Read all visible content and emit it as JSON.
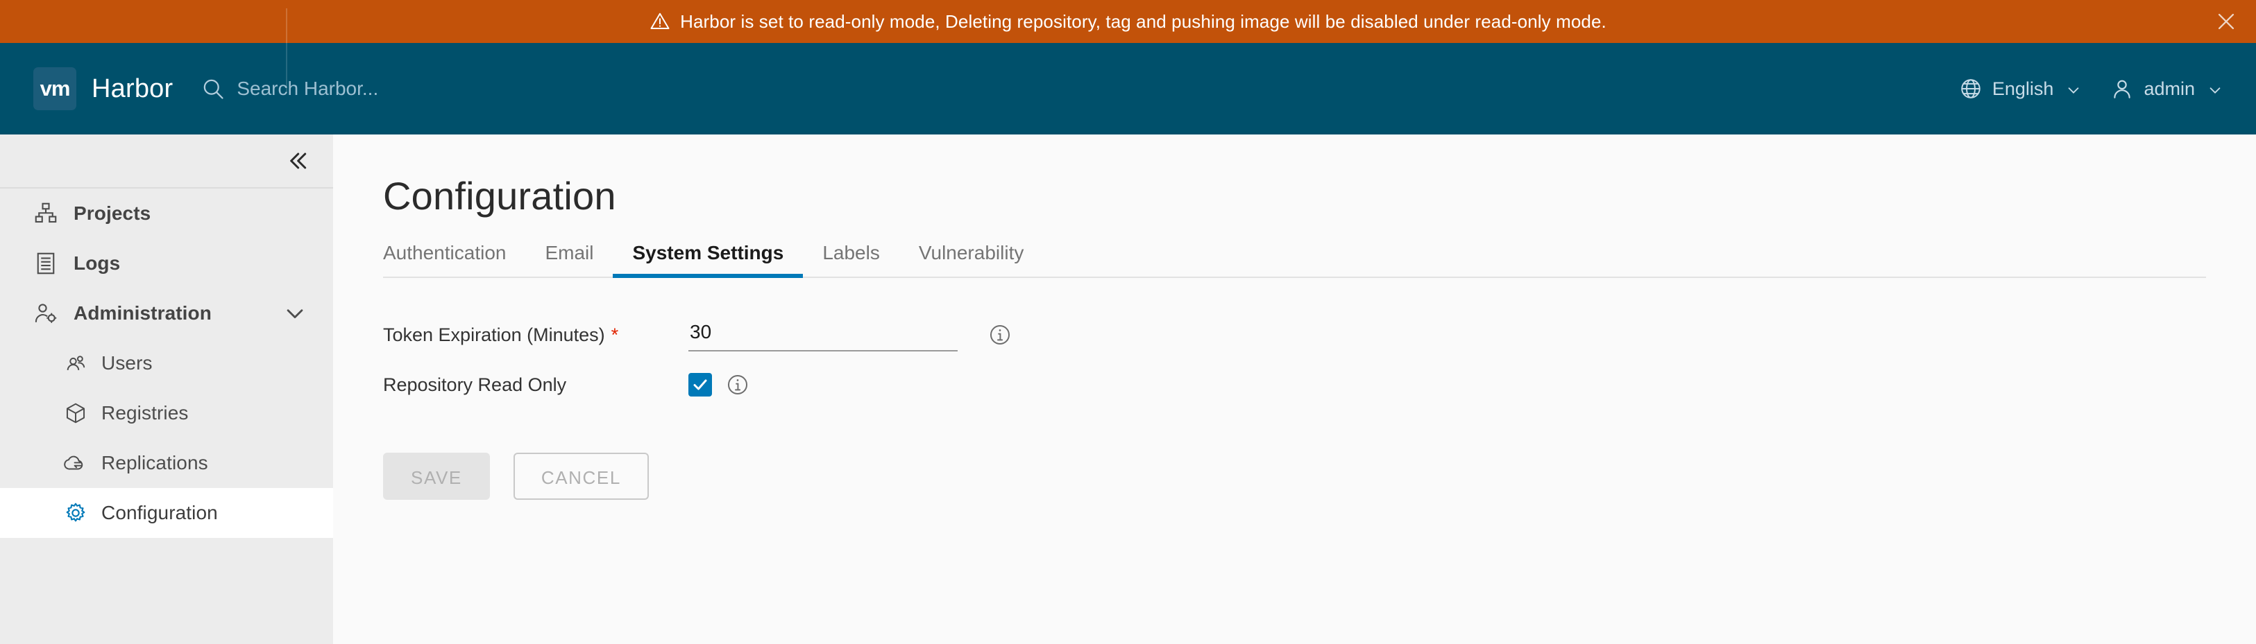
{
  "alert": {
    "message": "Harbor is set to read-only mode, Deleting repository, tag and pushing image will be disabled under read-only mode.",
    "icon": "warning-triangle-icon",
    "close_icon": "close-icon",
    "bg_color": "#c2520a",
    "text_color": "#ffffff"
  },
  "header": {
    "logo_text": "vm",
    "product_name": "Harbor",
    "bg_color": "#00506b",
    "search": {
      "placeholder": "Search Harbor...",
      "value": "",
      "icon": "search-icon"
    },
    "language": {
      "label": "English",
      "icon": "globe-icon",
      "chevron": "chevron-down-icon"
    },
    "account": {
      "label": "admin",
      "icon": "user-icon",
      "chevron": "chevron-down-icon"
    }
  },
  "sidebar": {
    "bg_color": "#ececec",
    "collapse_icon": "double-chevron-left-icon",
    "items": [
      {
        "label": "Projects",
        "icon": "projects-icon",
        "type": "item",
        "active": false
      },
      {
        "label": "Logs",
        "icon": "logs-icon",
        "type": "item",
        "active": false
      },
      {
        "label": "Administration",
        "icon": "administration-icon",
        "type": "group",
        "expanded": true,
        "chevron": "chevron-down-icon"
      },
      {
        "label": "Users",
        "icon": "users-icon",
        "type": "sub",
        "active": false
      },
      {
        "label": "Registries",
        "icon": "registries-icon",
        "type": "sub",
        "active": false
      },
      {
        "label": "Replications",
        "icon": "replications-icon",
        "type": "sub",
        "active": false
      },
      {
        "label": "Configuration",
        "icon": "gear-icon",
        "type": "sub",
        "active": true
      }
    ]
  },
  "main": {
    "page_title": "Configuration",
    "accent_color": "#0079b8",
    "tabs": [
      {
        "label": "Authentication",
        "active": false
      },
      {
        "label": "Email",
        "active": false
      },
      {
        "label": "System Settings",
        "active": true
      },
      {
        "label": "Labels",
        "active": false
      },
      {
        "label": "Vulnerability",
        "active": false
      }
    ],
    "fields": {
      "token_expiration": {
        "label": "Token Expiration (Minutes)",
        "required_marker": "*",
        "value": "30",
        "info_icon": "info-circle-icon"
      },
      "repository_read_only": {
        "label": "Repository Read Only",
        "checked": true,
        "checkbox_color": "#0079b8",
        "info_icon": "info-circle-icon"
      }
    },
    "buttons": {
      "save": {
        "label": "SAVE",
        "disabled": true
      },
      "cancel": {
        "label": "CANCEL",
        "disabled": true
      }
    }
  }
}
